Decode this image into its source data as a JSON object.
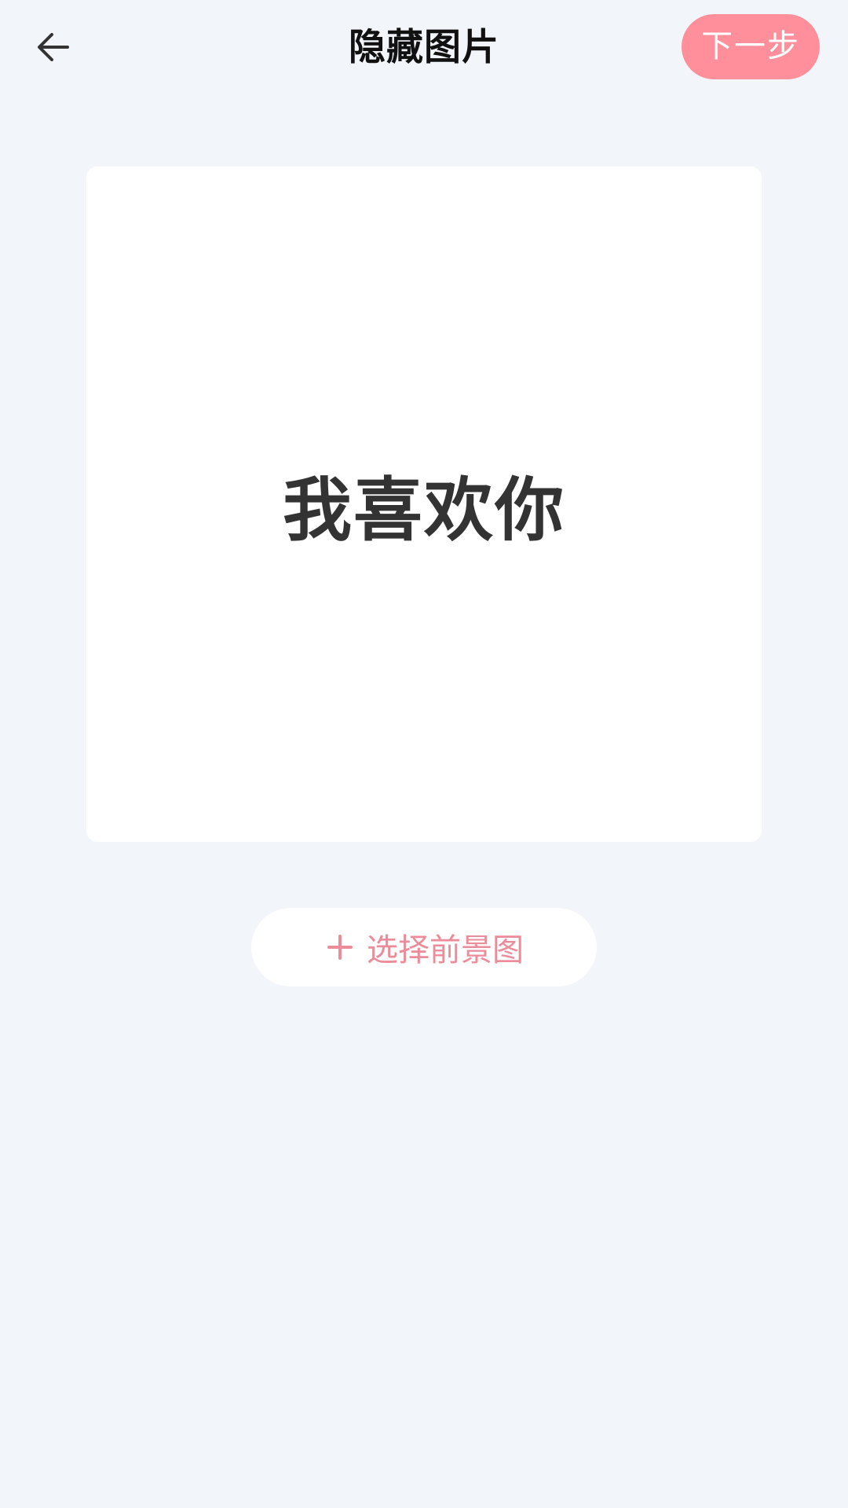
{
  "header": {
    "back_icon": "arrow-left-icon",
    "title": "隐藏图片",
    "next_label": "下一步"
  },
  "preview": {
    "text": "我喜欢你"
  },
  "actions": {
    "plus_icon": "plus-icon",
    "select_label": "选择前景图"
  },
  "colors": {
    "background": "#f2f5f9",
    "accent": "#ff8f9b",
    "accent_text": "#ec8c9a",
    "card": "#ffffff",
    "title": "#111111",
    "preview_text": "#333333"
  }
}
